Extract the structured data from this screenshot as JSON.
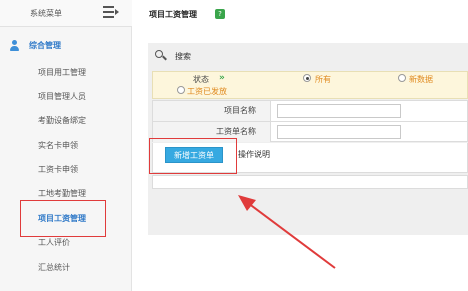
{
  "sidebar": {
    "title": "系统菜单",
    "section_label": "综合管理",
    "items": [
      {
        "label": "项目用工管理"
      },
      {
        "label": "项目管理人员"
      },
      {
        "label": "考勤设备绑定"
      },
      {
        "label": "实名卡申领"
      },
      {
        "label": "工资卡申领"
      },
      {
        "label": "工地考勤管理"
      },
      {
        "label": "项目工资管理"
      },
      {
        "label": "工人评价"
      },
      {
        "label": "汇总统计"
      }
    ]
  },
  "header": {
    "title": "项目工资管理",
    "help_icon": "help-icon"
  },
  "search": {
    "label": "搜索"
  },
  "filter": {
    "status_label": "状态",
    "status_arrow": "»",
    "options": [
      {
        "label": "所有",
        "selected": true
      },
      {
        "label": "新数据",
        "selected": false
      },
      {
        "label": "工资已发放",
        "selected": false
      }
    ]
  },
  "form": {
    "project_name_label": "项目名称",
    "payroll_name_label": "工资单名称"
  },
  "actions": {
    "new_payroll_label": "新增工资单",
    "instructions_label": "操作说明"
  },
  "colors": {
    "accent": "#2f79c8",
    "button": "#36a9e1",
    "highlight": "#e03b3b",
    "radio_text": "#e08a1f"
  }
}
